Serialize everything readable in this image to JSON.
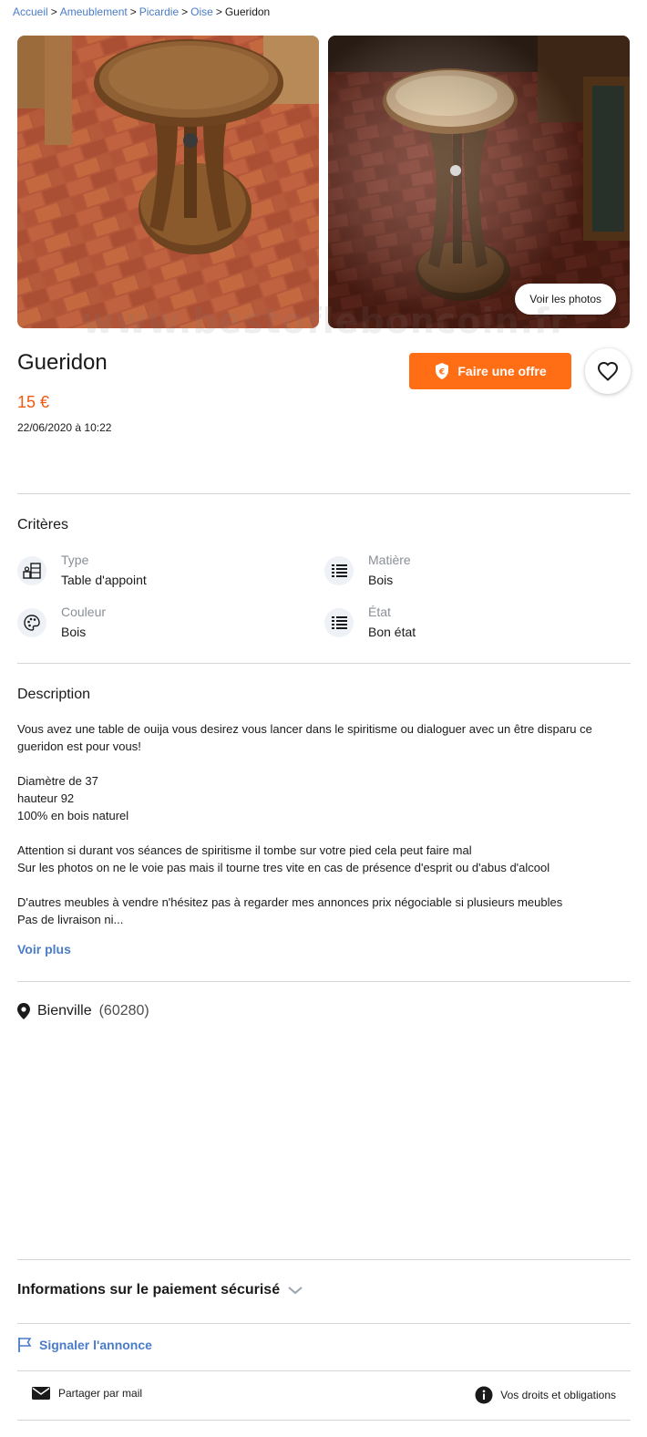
{
  "breadcrumb": {
    "items": [
      "Accueil",
      "Ameublement",
      "Picardie",
      "Oise"
    ],
    "current": "Gueridon",
    "separator": ">"
  },
  "gallery": {
    "view_photos_label": "Voir les photos",
    "watermark": "www.bestofleboncoin.fr"
  },
  "listing": {
    "title": "Gueridon",
    "price": "15 €",
    "date": "22/06/2020 à 10:22",
    "offer_button": "Faire une offre",
    "accent_color": "#ff6e14",
    "price_color": "#ec5a13"
  },
  "criteria": {
    "heading": "Critères",
    "items": [
      {
        "label": "Type",
        "value": "Table d'appoint",
        "icon": "furniture-icon"
      },
      {
        "label": "Matière",
        "value": "Bois",
        "icon": "list-icon"
      },
      {
        "label": "Couleur",
        "value": "Bois",
        "icon": "palette-icon"
      },
      {
        "label": "État",
        "value": "Bon état",
        "icon": "list-icon"
      }
    ]
  },
  "description": {
    "heading": "Description",
    "lines": [
      "Vous avez une table de ouija vous desirez vous lancer dans le spiritisme ou dialoguer avec un être disparu ce",
      "gueridon est pour vous!",
      "",
      "Diamètre de 37",
      "hauteur 92",
      "100% en bois naturel",
      "",
      "Attention si durant vos séances de spiritisme il tombe sur votre pied cela peut faire mal",
      "Sur les photos on ne le voie pas mais il tourne tres vite en cas de présence d'esprit ou d'abus d'alcool",
      "",
      "D'autres meubles à vendre n'hésitez pas à regarder mes annonces prix négociable si plusieurs meubles",
      "Pas de livraison ni..."
    ],
    "more_label": "Voir plus"
  },
  "location": {
    "city": "Bienville",
    "zip": "(60280)"
  },
  "footer": {
    "secure_payment": "Informations sur le paiement sécurisé",
    "report": "Signaler l'annonce",
    "share": "Partager par mail",
    "rights": "Vos droits et obligations",
    "link_color": "#4a7cc7"
  }
}
